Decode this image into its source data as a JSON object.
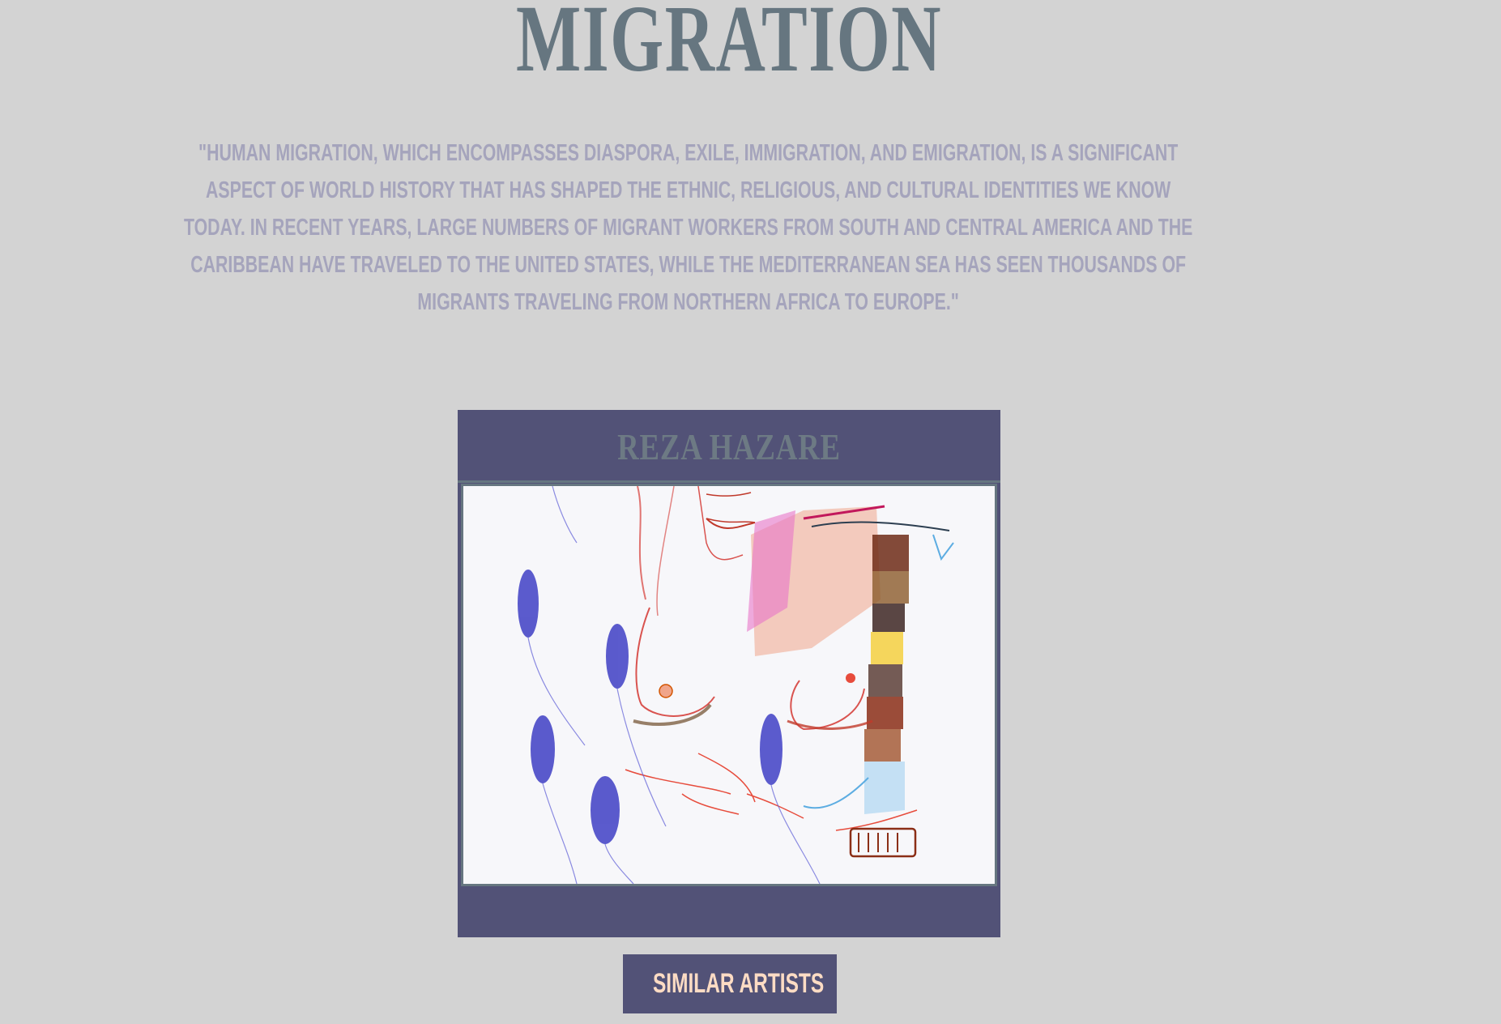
{
  "page": {
    "title": "MIGRATION",
    "quote": "\"Human migration, which encompasses diaspora, exile, immigration, and emigration, is a significant aspect of world history that has shaped the ethnic, religious, and cultural identities we know today. In recent years, large numbers of migrant workers from South and Central America and the Caribbean have traveled to the United States, while the Mediterranean sea has seen thousands of migrants traveling from Northern Africa to Europe.\""
  },
  "artist_card": {
    "name": "REZA HAZARE",
    "artwork": "colored-pencil drawing of a figure with blue seed-like shapes"
  },
  "similar_button": {
    "label": "SIMILAR ARTISTS"
  },
  "colors": {
    "background": "#d3d3d3",
    "title": "#667680",
    "quote": "#a5a4bc",
    "card": "#525277",
    "button_text": "#fddcc4"
  }
}
